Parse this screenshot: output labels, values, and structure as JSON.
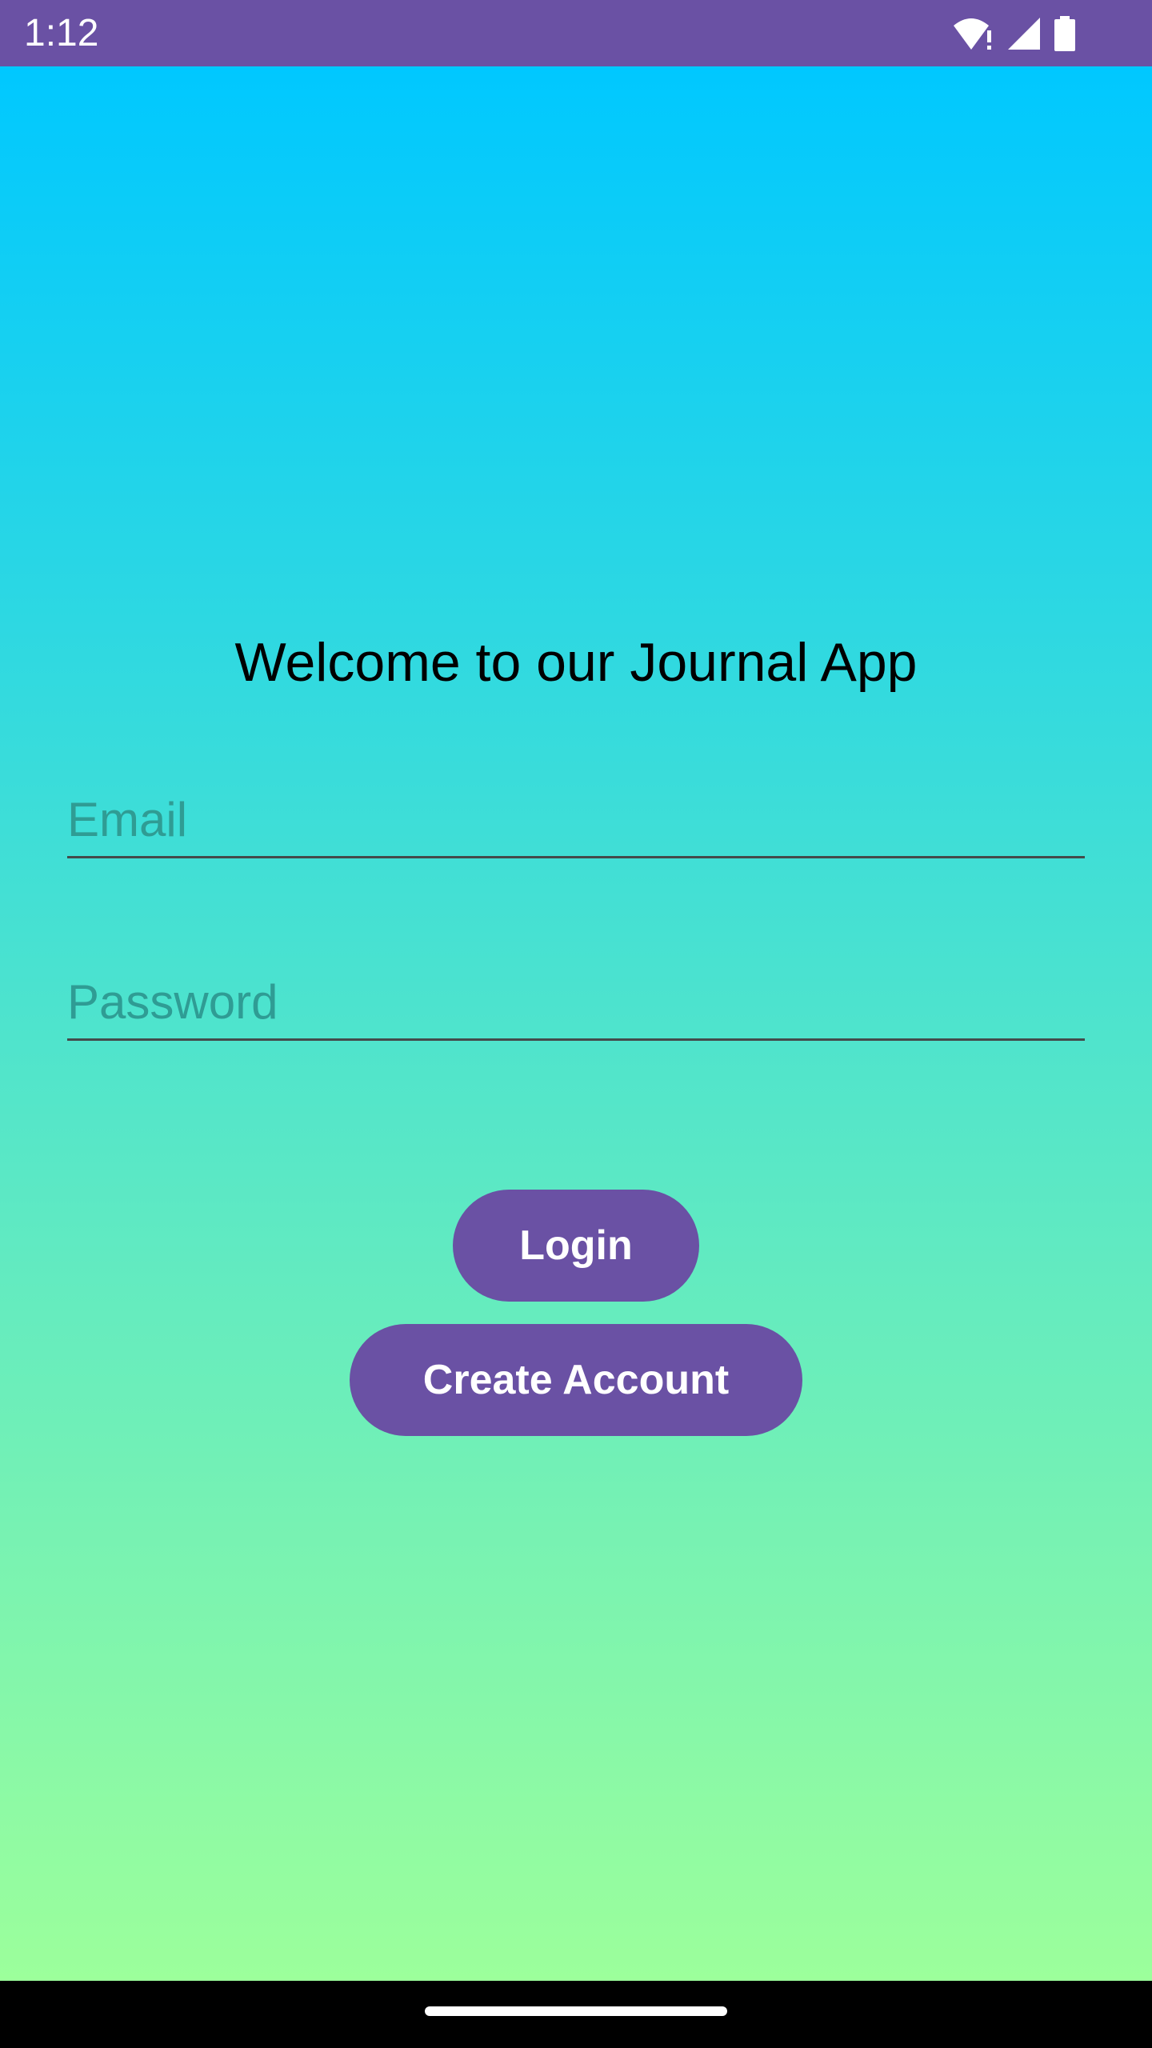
{
  "status_bar": {
    "time": "1:12",
    "icons": [
      "wifi-alert-icon",
      "cellular-signal-icon",
      "battery-icon"
    ],
    "background": "#6a51a4"
  },
  "main": {
    "title": "Welcome to our Journal App",
    "email_placeholder": "Email",
    "password_placeholder": "Password",
    "login_label": "Login",
    "create_account_label": "Create Account",
    "gradient_top": "#00c8ff",
    "gradient_bottom": "#9cff9b",
    "button_color": "#6a51a4"
  }
}
